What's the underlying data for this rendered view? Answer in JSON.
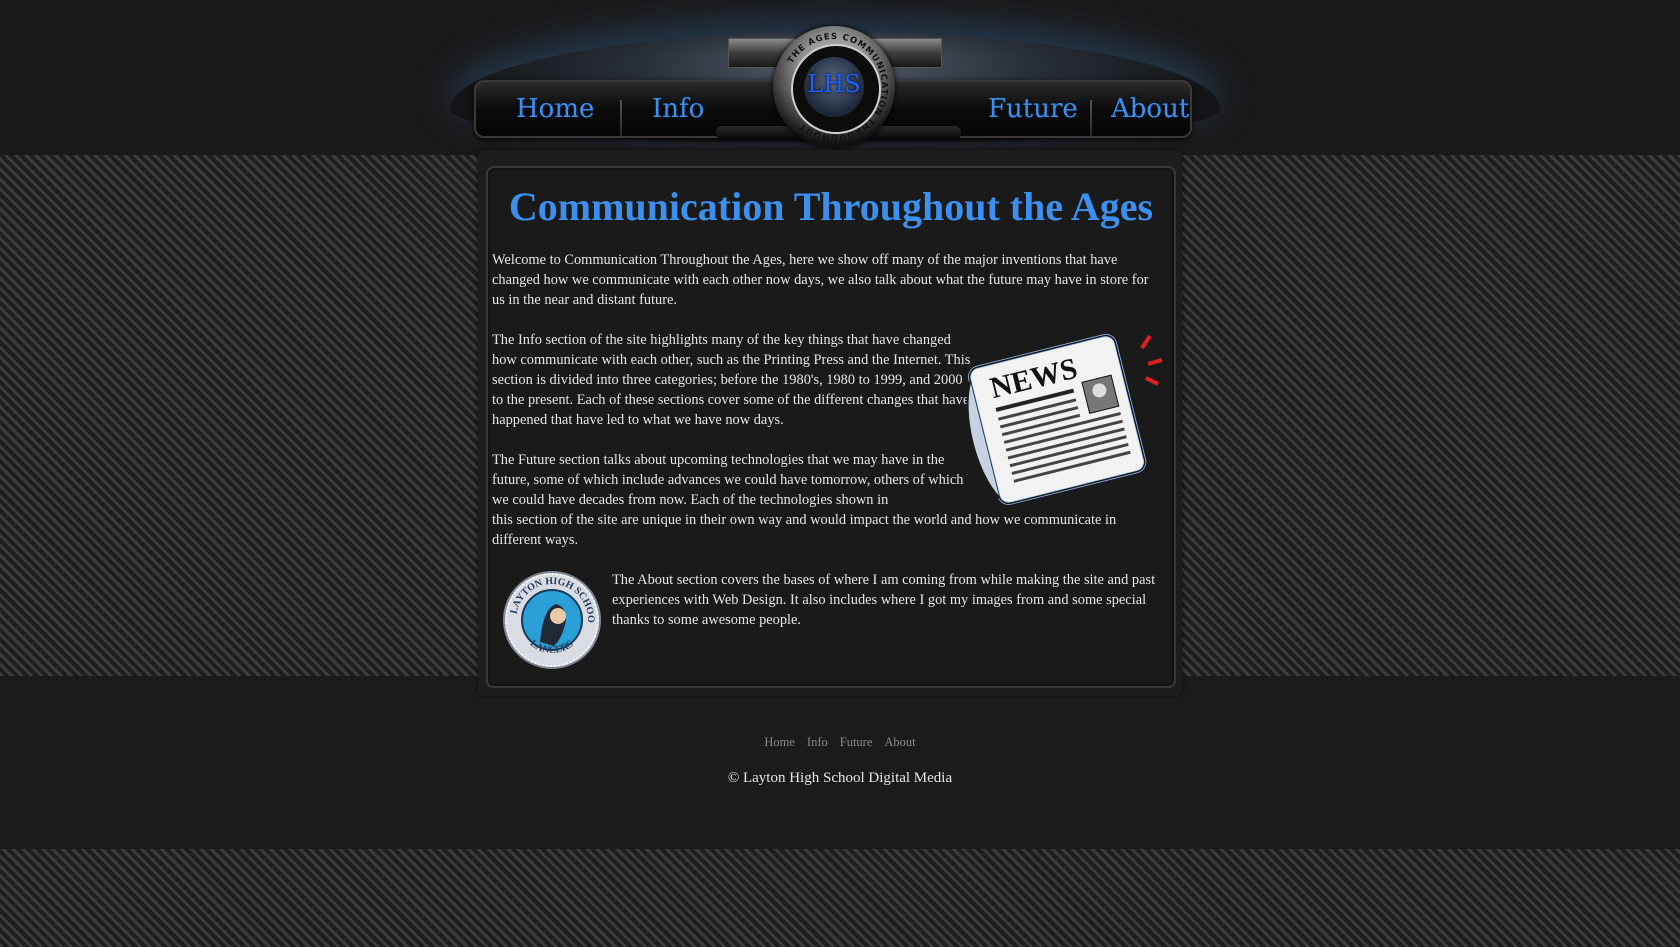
{
  "nav": {
    "home": "Home",
    "info": "Info",
    "future": "Future",
    "about": "About",
    "logo_text": "LHS",
    "logo_ring_text": "THE AGES COMMUNICATION THROUGHOUT"
  },
  "main": {
    "title": "Communication Throughout the Ages",
    "welcome": "Welcome to Communication Throughout the Ages, here we show off many of the major inventions that have changed how we communicate with each other now days, we also talk about what the future may have in store for us in the near and distant future.",
    "info": "The Info section of the site highlights many of the key things that have changed how communicate with each other, such as the Printing Press and the Internet. This section is divided into three categories; before the 1980's, 1980 to 1999, and 2000 to the present. Each of these sections cover some of the different changes that have happened that have led to what we have now days.",
    "future_a": "The Future section talks about upcoming technologies that we may have in the future, some of which include advances we could have tomorrow, others of which we could have decades from now. Each of the technologies shown in",
    "future_b": "this section of the site are unique in their own way and would impact the world and how we communicate in different ways.",
    "about": "The About section covers the bases of where I am coming from while making the site and past experiences with Web Design. It also includes where I got my images from and some special thanks to some awesome people.",
    "news_word": "NEWS",
    "seal_top": "LAYTON HIGH SCHOOL",
    "seal_bottom": "LANCERS"
  },
  "footer": {
    "links": [
      "Home",
      "Info",
      "Future",
      "About"
    ],
    "copyright": "© Layton High School Digital Media"
  },
  "colors": {
    "accent": "#3d8fed",
    "background": "#1b1b1b",
    "text": "#e6e6e6"
  }
}
